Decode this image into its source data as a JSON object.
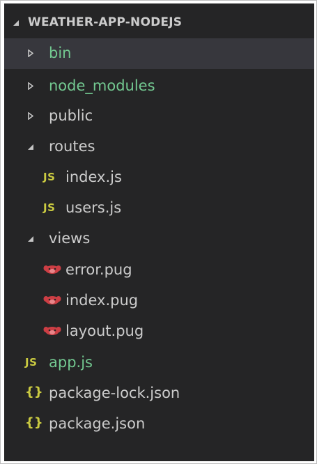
{
  "explorer": {
    "project_title": "WEATHER-APP-NODEJS",
    "items": [
      {
        "label": "bin",
        "kind": "folder",
        "state": "collapsed",
        "color": "#73c991"
      },
      {
        "label": "node_modules",
        "kind": "folder",
        "state": "collapsed",
        "color": "#73c991"
      },
      {
        "label": "public",
        "kind": "folder",
        "state": "collapsed",
        "color": "#cccccc"
      },
      {
        "label": "routes",
        "kind": "folder",
        "state": "expanded",
        "color": "#cccccc"
      },
      {
        "label": "index.js",
        "kind": "file",
        "icon": "JS",
        "color": "#cccccc"
      },
      {
        "label": "users.js",
        "kind": "file",
        "icon": "JS",
        "color": "#cccccc"
      },
      {
        "label": "views",
        "kind": "folder",
        "state": "expanded",
        "color": "#cccccc"
      },
      {
        "label": "error.pug",
        "kind": "file",
        "icon": "pug-icon",
        "color": "#cccccc"
      },
      {
        "label": "index.pug",
        "kind": "file",
        "icon": "pug-icon",
        "color": "#cccccc"
      },
      {
        "label": "layout.pug",
        "kind": "file",
        "icon": "pug-icon",
        "color": "#cccccc"
      },
      {
        "label": "app.js",
        "kind": "file",
        "icon": "JS",
        "color": "#73c991"
      },
      {
        "label": "package-lock.json",
        "kind": "file",
        "icon": "{}",
        "color": "#cccccc"
      },
      {
        "label": "package.json",
        "kind": "file",
        "icon": "{}",
        "color": "#cccccc"
      }
    ]
  },
  "colors": {
    "background": "#252526",
    "selected_row": "#37373d",
    "text": "#cccccc",
    "git_untracked_green": "#73c991",
    "js_icon": "#cbcb41",
    "json_icon": "#cbcb41",
    "pug_icon": "#cc3e44"
  }
}
